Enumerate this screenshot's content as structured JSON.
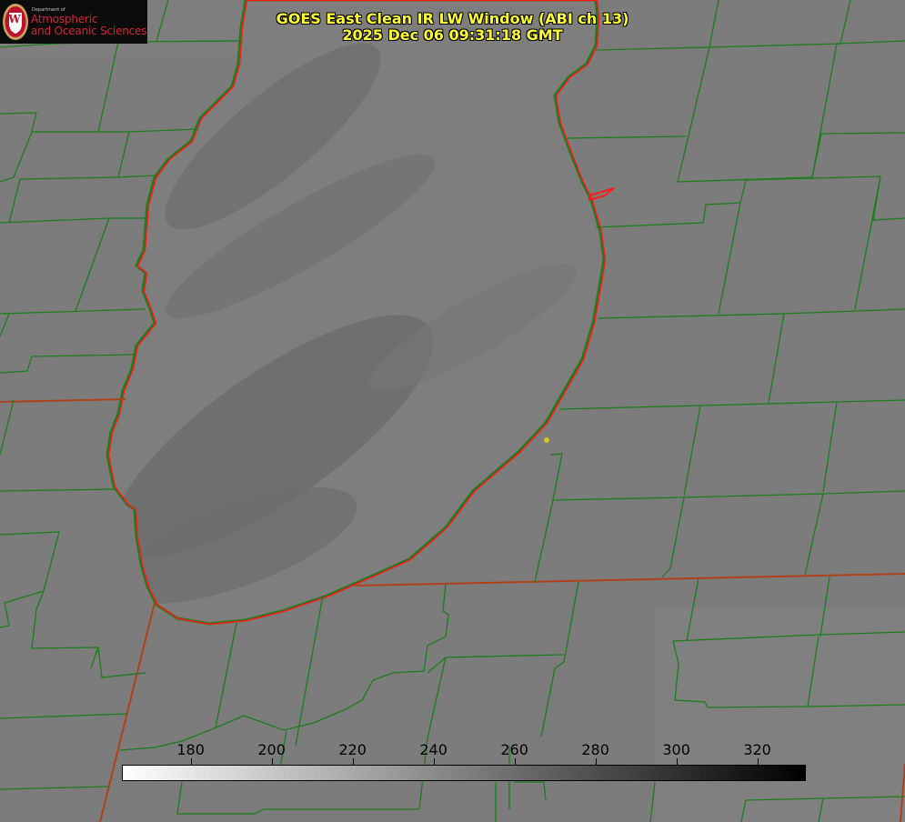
{
  "title": {
    "line1": "GOES East Clean IR LW Window (ABI ch 13)",
    "line2": "2025 Dec 06 09:31:18 GMT"
  },
  "logo": {
    "dept": "Department of",
    "line1": "Atmospheric",
    "line2": "and Oceanic Sciences",
    "seal_letter": "W"
  },
  "colorbar": {
    "ticks": [
      "180",
      "200",
      "220",
      "240",
      "260",
      "280",
      "300",
      "320"
    ],
    "min": 163,
    "max": 332,
    "colormap": "white-to-black",
    "units": ""
  },
  "colors": {
    "background_gray": "#7c7c7c",
    "lake_gray": "#7e7e7e",
    "county_line": "#1b7d1b",
    "state_line": "#d42a1a",
    "coast_red": "#ff1a1a",
    "title_yellow": "#ffff33",
    "marker_yellow": "#d6c619"
  },
  "map": {
    "features": [
      "county-boundaries",
      "state-boundaries",
      "lake-michigan-shoreline",
      "station-marker"
    ]
  }
}
